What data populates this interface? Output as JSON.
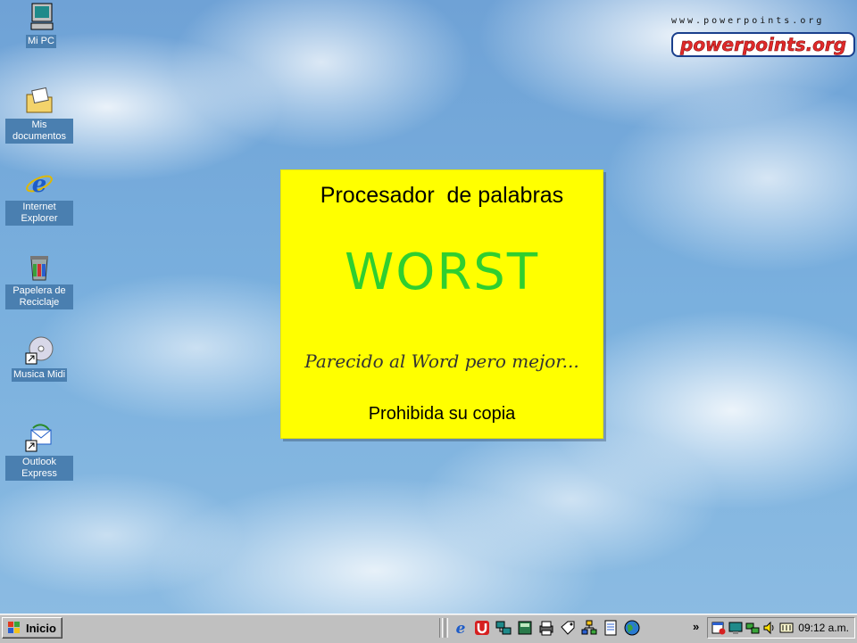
{
  "desktop": {
    "icons": [
      {
        "label": "Mi PC",
        "icon": "my-computer-icon"
      },
      {
        "label": "Mis documentos",
        "icon": "my-documents-icon"
      },
      {
        "label": "Internet Explorer",
        "icon": "internet-explorer-icon"
      },
      {
        "label": "Papelera de Reciclaje",
        "icon": "recycle-bin-icon"
      },
      {
        "label": "Musica Midi",
        "icon": "music-cd-shortcut-icon"
      },
      {
        "label": "Outlook Express",
        "icon": "outlook-express-icon"
      }
    ]
  },
  "logo": {
    "url_text": "www.powerpoints.org",
    "brand_text": "powerpoints.org"
  },
  "note": {
    "heading": "Procesador  de palabras",
    "product": "WORST",
    "tagline": "Parecido al Word pero mejor...",
    "footer": "Prohibida su copia",
    "background_color": "#ffff00",
    "product_color": "#2fcf2f"
  },
  "taskbar": {
    "start_label": "Inicio",
    "quick_launch": [
      "internet-explorer-icon",
      "red-u-app-icon",
      "network-icon",
      "calculator-icon",
      "printer-icon",
      "tag-icon",
      "org-chart-icon",
      "notepad-icon",
      "globe-icon"
    ],
    "overflow_label": "»",
    "tray_icons": [
      "schedule-icon",
      "monitor-icon",
      "network-tray-icon",
      "volume-icon",
      "keyboard-icon"
    ],
    "clock": "09:12 a.m."
  }
}
